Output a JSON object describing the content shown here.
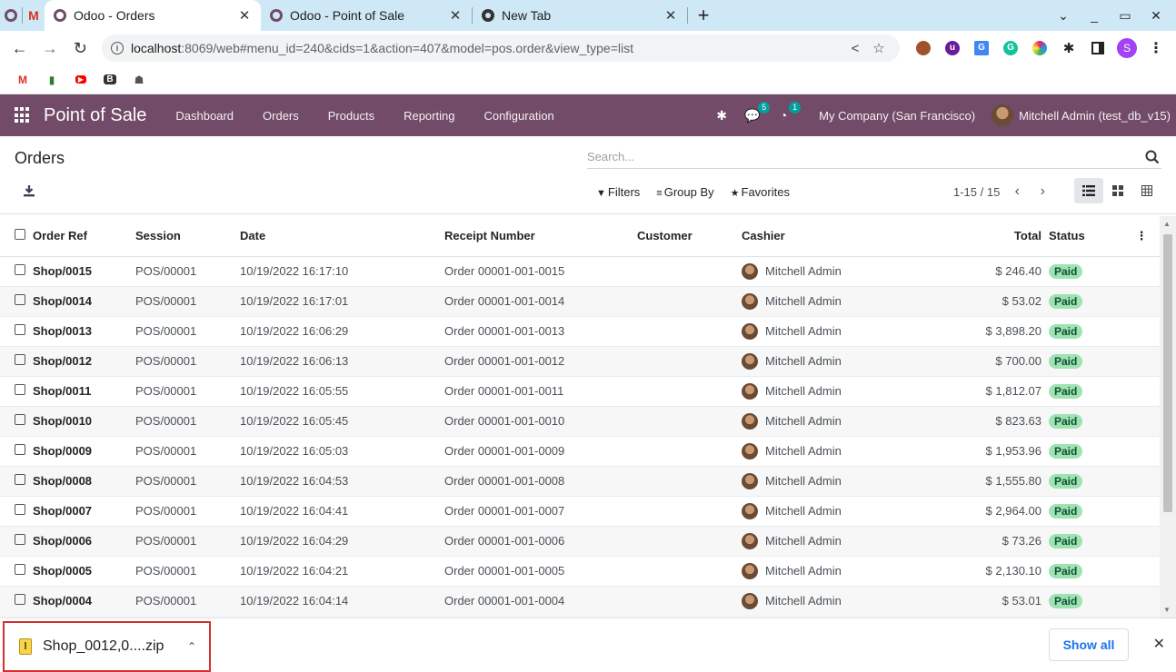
{
  "browser": {
    "tabs": [
      {
        "title": "Odoo - Orders",
        "active": true
      },
      {
        "title": "Odoo - Point of Sale",
        "active": false
      },
      {
        "title": "New Tab",
        "active": false
      }
    ],
    "url_host": "localhost",
    "url_rest": ":8069/web#menu_id=240&cids=1&action=407&model=pos.order&view_type=list"
  },
  "navbar": {
    "app_name": "Point of Sale",
    "menu": [
      "Dashboard",
      "Orders",
      "Products",
      "Reporting",
      "Configuration"
    ],
    "messages_count": "5",
    "activities_count": "1",
    "company": "My Company (San Francisco)",
    "user": "Mitchell Admin (test_db_v15)"
  },
  "control_panel": {
    "breadcrumb": "Orders",
    "search_placeholder": "Search...",
    "filters_label": "Filters",
    "groupby_label": "Group By",
    "favorites_label": "Favorites",
    "pager": "1-15 / 15"
  },
  "table": {
    "columns": [
      "Order Ref",
      "Session",
      "Date",
      "Receipt Number",
      "Customer",
      "Cashier",
      "Total",
      "Status"
    ],
    "rows": [
      {
        "ref": "Shop/0015",
        "session": "POS/00001",
        "date": "10/19/2022 16:17:10",
        "receipt": "Order 00001-001-0015",
        "customer": "",
        "cashier": "Mitchell Admin",
        "total": "$ 246.40",
        "status": "Paid"
      },
      {
        "ref": "Shop/0014",
        "session": "POS/00001",
        "date": "10/19/2022 16:17:01",
        "receipt": "Order 00001-001-0014",
        "customer": "",
        "cashier": "Mitchell Admin",
        "total": "$ 53.02",
        "status": "Paid"
      },
      {
        "ref": "Shop/0013",
        "session": "POS/00001",
        "date": "10/19/2022 16:06:29",
        "receipt": "Order 00001-001-0013",
        "customer": "",
        "cashier": "Mitchell Admin",
        "total": "$ 3,898.20",
        "status": "Paid"
      },
      {
        "ref": "Shop/0012",
        "session": "POS/00001",
        "date": "10/19/2022 16:06:13",
        "receipt": "Order 00001-001-0012",
        "customer": "",
        "cashier": "Mitchell Admin",
        "total": "$ 700.00",
        "status": "Paid"
      },
      {
        "ref": "Shop/0011",
        "session": "POS/00001",
        "date": "10/19/2022 16:05:55",
        "receipt": "Order 00001-001-0011",
        "customer": "",
        "cashier": "Mitchell Admin",
        "total": "$ 1,812.07",
        "status": "Paid"
      },
      {
        "ref": "Shop/0010",
        "session": "POS/00001",
        "date": "10/19/2022 16:05:45",
        "receipt": "Order 00001-001-0010",
        "customer": "",
        "cashier": "Mitchell Admin",
        "total": "$ 823.63",
        "status": "Paid"
      },
      {
        "ref": "Shop/0009",
        "session": "POS/00001",
        "date": "10/19/2022 16:05:03",
        "receipt": "Order 00001-001-0009",
        "customer": "",
        "cashier": "Mitchell Admin",
        "total": "$ 1,953.96",
        "status": "Paid"
      },
      {
        "ref": "Shop/0008",
        "session": "POS/00001",
        "date": "10/19/2022 16:04:53",
        "receipt": "Order 00001-001-0008",
        "customer": "",
        "cashier": "Mitchell Admin",
        "total": "$ 1,555.80",
        "status": "Paid"
      },
      {
        "ref": "Shop/0007",
        "session": "POS/00001",
        "date": "10/19/2022 16:04:41",
        "receipt": "Order 00001-001-0007",
        "customer": "",
        "cashier": "Mitchell Admin",
        "total": "$ 2,964.00",
        "status": "Paid"
      },
      {
        "ref": "Shop/0006",
        "session": "POS/00001",
        "date": "10/19/2022 16:04:29",
        "receipt": "Order 00001-001-0006",
        "customer": "",
        "cashier": "Mitchell Admin",
        "total": "$ 73.26",
        "status": "Paid"
      },
      {
        "ref": "Shop/0005",
        "session": "POS/00001",
        "date": "10/19/2022 16:04:21",
        "receipt": "Order 00001-001-0005",
        "customer": "",
        "cashier": "Mitchell Admin",
        "total": "$ 2,130.10",
        "status": "Paid"
      },
      {
        "ref": "Shop/0004",
        "session": "POS/00001",
        "date": "10/19/2022 16:04:14",
        "receipt": "Order 00001-001-0004",
        "customer": "",
        "cashier": "Mitchell Admin",
        "total": "$ 53.01",
        "status": "Paid"
      }
    ]
  },
  "downloads": {
    "file_name": "Shop_0012,0....zip",
    "show_all": "Show all"
  },
  "colors": {
    "brand": "#714b67",
    "tabstrip": "#cfe8f5",
    "paid_badge": "#9fe3b3",
    "highlight_border": "#d32f2f"
  }
}
